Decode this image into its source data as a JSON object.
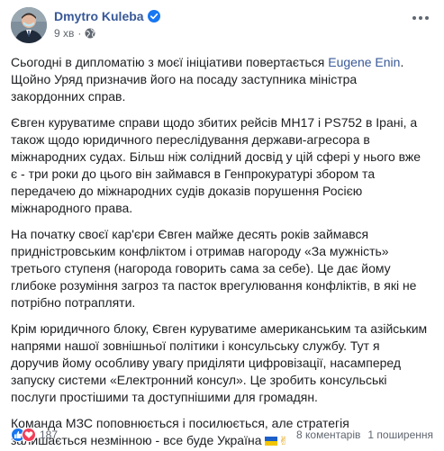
{
  "header": {
    "author": "Dmytro Kuleba",
    "time": "9 хв",
    "separator": "·"
  },
  "post": {
    "paragraphs": [
      {
        "before": "Сьогодні в дипломатію з моєї ініціативи повертається ",
        "mention": "Eugene Enin",
        "after": ". Щойно Уряд призначив його на посаду заступника міністра закордонних справ."
      },
      {
        "text": "Євген куруватиме справи щодо збитих рейсів MH17 і PS752 в Ірані, а також щодо юридичного переслідування держави-агресора в міжнародних судах. Більш ніж солідний досвід у цій сфері у нього вже є - три роки до цього він займався в Генпрокуратурі збором та передачею до міжнародних судів доказів порушення Росією міжнародного права."
      },
      {
        "text": "На початку своєї кар'єри Євген майже десять років займався придністровським конфліктом і отримав нагороду «За мужність» третього ступеня (нагорода говорить сама за себе). Це дає йому глибоке розуміння загроз та пасток врегулювання конфліктів, в які не потрібно потрапляти."
      },
      {
        "text": "Крім юридичного блоку, Євген куруватиме американським та азійським напрями нашої зовнішньої політики і консульську службу. Тут я доручив йому особливу увагу приділяти цифровізації, насамперед запуску системи «Електронний консул». Це зробить консульські послуги простішими та доступнішими для громадян."
      },
      {
        "text": "Команда МЗС поповнюється і посилюється, але стратегія залишається незмінною - все буде Україна",
        "emoji": "✌"
      }
    ]
  },
  "footer": {
    "reaction_count": "187",
    "comments": "8 коментарів",
    "shares": "1 поширення"
  },
  "icons": {
    "verified": "verified-badge-icon",
    "globe": "globe-icon",
    "more": "more-options-icon",
    "like": "like-reaction-icon",
    "love": "love-reaction-icon",
    "flag": "ukraine-flag-icon"
  },
  "colors": {
    "link": "#385898",
    "verified": "#1877f2",
    "like": "#1877f2",
    "love": "#f33e58",
    "flag_blue": "#1d5fc9",
    "flag_yellow": "#f2c500"
  }
}
